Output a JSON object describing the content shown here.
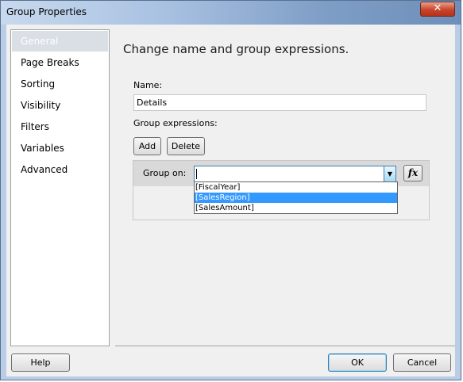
{
  "window": {
    "title": "Group Properties",
    "close_glyph": "✕"
  },
  "nav": {
    "items": [
      {
        "label": "General",
        "selected": true
      },
      {
        "label": "Page Breaks",
        "selected": false
      },
      {
        "label": "Sorting",
        "selected": false
      },
      {
        "label": "Visibility",
        "selected": false
      },
      {
        "label": "Filters",
        "selected": false
      },
      {
        "label": "Variables",
        "selected": false
      },
      {
        "label": "Advanced",
        "selected": false
      }
    ]
  },
  "main": {
    "heading": "Change name and group expressions.",
    "name_label": "Name:",
    "name_value": "Details",
    "group_expressions_label": "Group expressions:",
    "add_label": "Add",
    "delete_label": "Delete",
    "group_on_label": "Group on:",
    "group_on_value": "",
    "fx_label": "fx",
    "dropdown_options": [
      {
        "label": "[FiscalYear]",
        "selected": false
      },
      {
        "label": "[SalesRegion]",
        "selected": true
      },
      {
        "label": "[SalesAmount]",
        "selected": false
      }
    ]
  },
  "footer": {
    "help_label": "Help",
    "ok_label": "OK",
    "cancel_label": "Cancel"
  },
  "colors": {
    "selection": "#3399ff",
    "accent": "#3c7fb1"
  }
}
